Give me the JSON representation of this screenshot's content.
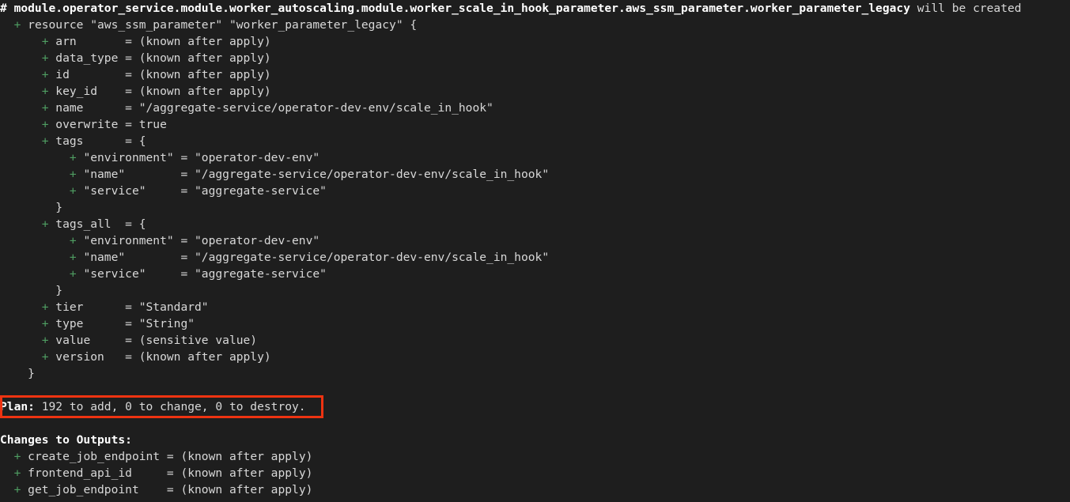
{
  "terminal": {
    "title": "terraform plan output",
    "background_color": "#1e1e1e",
    "text_color": "#d8d8d8",
    "plus_color": "#4f9e62",
    "bold_color": "#ffffff",
    "highlight_border_color": "#ee3311"
  },
  "resource_header": {
    "comment": "# module.operator_service.module.worker_autoscaling.module.worker_scale_in_hook_parameter.aws_ssm_parameter.worker_parameter_legacy",
    "suffix": " will be created"
  },
  "resource_block": {
    "open": "  + resource \"aws_ssm_parameter\" \"worker_parameter_legacy\" {",
    "close": "    }"
  },
  "attributes": [
    {
      "plus": "      + ",
      "text": "arn       = (known after apply)"
    },
    {
      "plus": "      + ",
      "text": "data_type = (known after apply)"
    },
    {
      "plus": "      + ",
      "text": "id        = (known after apply)"
    },
    {
      "plus": "      + ",
      "text": "key_id    = (known after apply)"
    },
    {
      "plus": "      + ",
      "text": "name      = \"/aggregate-service/operator-dev-env/scale_in_hook\""
    },
    {
      "plus": "      + ",
      "text": "overwrite = true"
    },
    {
      "plus": "      + ",
      "text": "tags      = {"
    },
    {
      "plus": "          + ",
      "text": "\"environment\" = \"operator-dev-env\""
    },
    {
      "plus": "          + ",
      "text": "\"name\"        = \"/aggregate-service/operator-dev-env/scale_in_hook\""
    },
    {
      "plus": "          + ",
      "text": "\"service\"     = \"aggregate-service\""
    },
    {
      "plus": "        ",
      "text": "}"
    },
    {
      "plus": "      + ",
      "text": "tags_all  = {"
    },
    {
      "plus": "          + ",
      "text": "\"environment\" = \"operator-dev-env\""
    },
    {
      "plus": "          + ",
      "text": "\"name\"        = \"/aggregate-service/operator-dev-env/scale_in_hook\""
    },
    {
      "plus": "          + ",
      "text": "\"service\"     = \"aggregate-service\""
    },
    {
      "plus": "        ",
      "text": "}"
    },
    {
      "plus": "      + ",
      "text": "tier      = \"Standard\""
    },
    {
      "plus": "      + ",
      "text": "type      = \"String\""
    },
    {
      "plus": "      + ",
      "text": "value     = (sensitive value)"
    },
    {
      "plus": "      + ",
      "text": "version   = (known after apply)"
    }
  ],
  "plan_summary": {
    "label": "Plan:",
    "detail": " 192 to add, 0 to change, 0 to destroy.",
    "to_add": 192,
    "to_change": 0,
    "to_destroy": 0
  },
  "outputs_section": {
    "heading": "Changes to Outputs:",
    "items": [
      {
        "plus": "  + ",
        "text": "create_job_endpoint = (known after apply)"
      },
      {
        "plus": "  + ",
        "text": "frontend_api_id     = (known after apply)"
      },
      {
        "plus": "  + ",
        "text": "get_job_endpoint    = (known after apply)"
      }
    ]
  }
}
